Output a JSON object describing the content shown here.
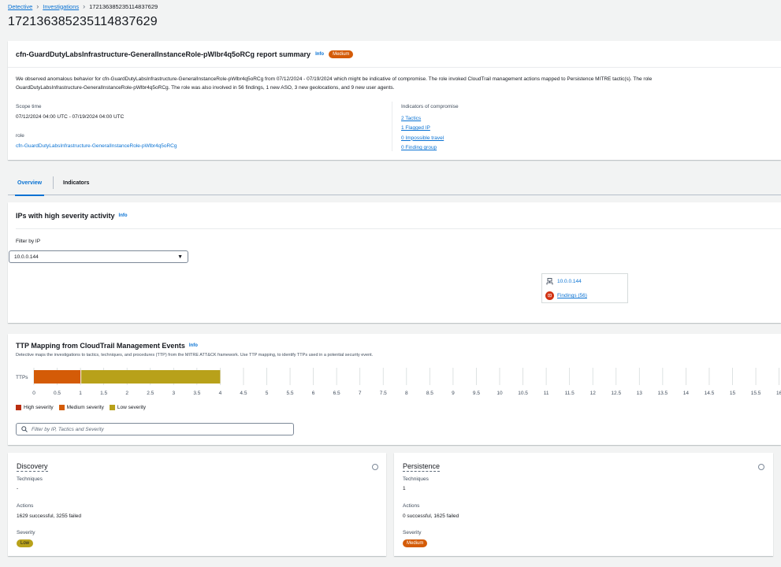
{
  "breadcrumb": [
    "Detective",
    "Investigations",
    "172136385235114837629"
  ],
  "page_title": "172136385235114837629",
  "summary": {
    "title": "cfn-GuardDutyLabsInfrastructure-GeneralInstanceRole-pWlbr4q5oRCg report summary",
    "info": "Info",
    "severity": "Medium",
    "desc_line1": "We observed anomalous behavior for cfn-GuardDutyLabsInfrastructure-GeneralInstanceRole-pWlbr4q5oRCg from 07/12/2024 - 07/19/2024 which might be indicative of compromise. The role invoked CloudTrail management actions mapped to Persistence MITRE tactic(s). The role",
    "desc_line2": "GuardDutyLabsInfrastructure-GeneralInstanceRole-pWlbr4q5oRCg. The role was also involved in 56 findings, 1 new ASO, 3 new geolocations, and 9 new user agents.",
    "scope_label": "Scope time",
    "scope_value": "07/12/2024 04:00 UTC - 07/19/2024 04:00 UTC",
    "role_label": "role",
    "role_value": "cfn-GuardDutyLabsInfrastructure-GeneralInstanceRole-pWlbr4q5oRCg",
    "ioc_label": "Indicators of compromise",
    "ioc_links": [
      "2 Tactics",
      "1 Flagged IP",
      "0 Impossible travel",
      "0 Finding group"
    ]
  },
  "tabs": [
    "Overview",
    "Indicators"
  ],
  "ips": {
    "title": "IPs with high severity activity",
    "info": "Info",
    "filter_label": "Filter by IP",
    "filter_value": "10.0.0.144",
    "card_ip": "10.0.0.144",
    "card_findings": "Findings (56)"
  },
  "ttp": {
    "title": "TTP Mapping from CloudTrail Management Events",
    "info": "Info",
    "desc": "Detective maps the investigations to tactics, techniques, and procedures (TTP) from the MITRE ATT&CK framework. Use TTP mapping, to identify TTPs used in a potential security event.",
    "search_placeholder": "Filter by IP, Tactics and Severity"
  },
  "chart_data": {
    "type": "bar",
    "orientation": "horizontal-stacked",
    "categories": [
      "TTPs"
    ],
    "series": [
      {
        "name": "High severity",
        "values": [
          0
        ],
        "color": "#ba2e0f"
      },
      {
        "name": "Medium severity",
        "values": [
          1
        ],
        "color": "#d45b07"
      },
      {
        "name": "Low severity",
        "values": [
          3
        ],
        "color": "#b8a11a"
      }
    ],
    "xticks": [
      "0",
      "0.5",
      "1",
      "1.5",
      "2",
      "2.5",
      "3",
      "3.5",
      "4",
      "4.5",
      "5",
      "5.5",
      "6",
      "6.5",
      "7",
      "7.5",
      "8",
      "8.5",
      "9",
      "9.5",
      "10",
      "10.5",
      "11",
      "11.5",
      "12",
      "12.5",
      "13",
      "13.5",
      "14",
      "14.5",
      "15",
      "15.5",
      "16"
    ],
    "xlim": [
      0,
      16
    ],
    "legend": "bottom-left"
  },
  "tactics": [
    {
      "name": "Discovery",
      "techniques_label": "Techniques",
      "techniques": "-",
      "actions_label": "Actions",
      "actions": "1629 successful, 3255 failed",
      "severity_label": "Severity",
      "severity": "Low"
    },
    {
      "name": "Persistence",
      "techniques_label": "Techniques",
      "techniques": "1",
      "actions_label": "Actions",
      "actions": "0 successful, 1625 failed",
      "severity_label": "Severity",
      "severity": "Medium"
    }
  ]
}
